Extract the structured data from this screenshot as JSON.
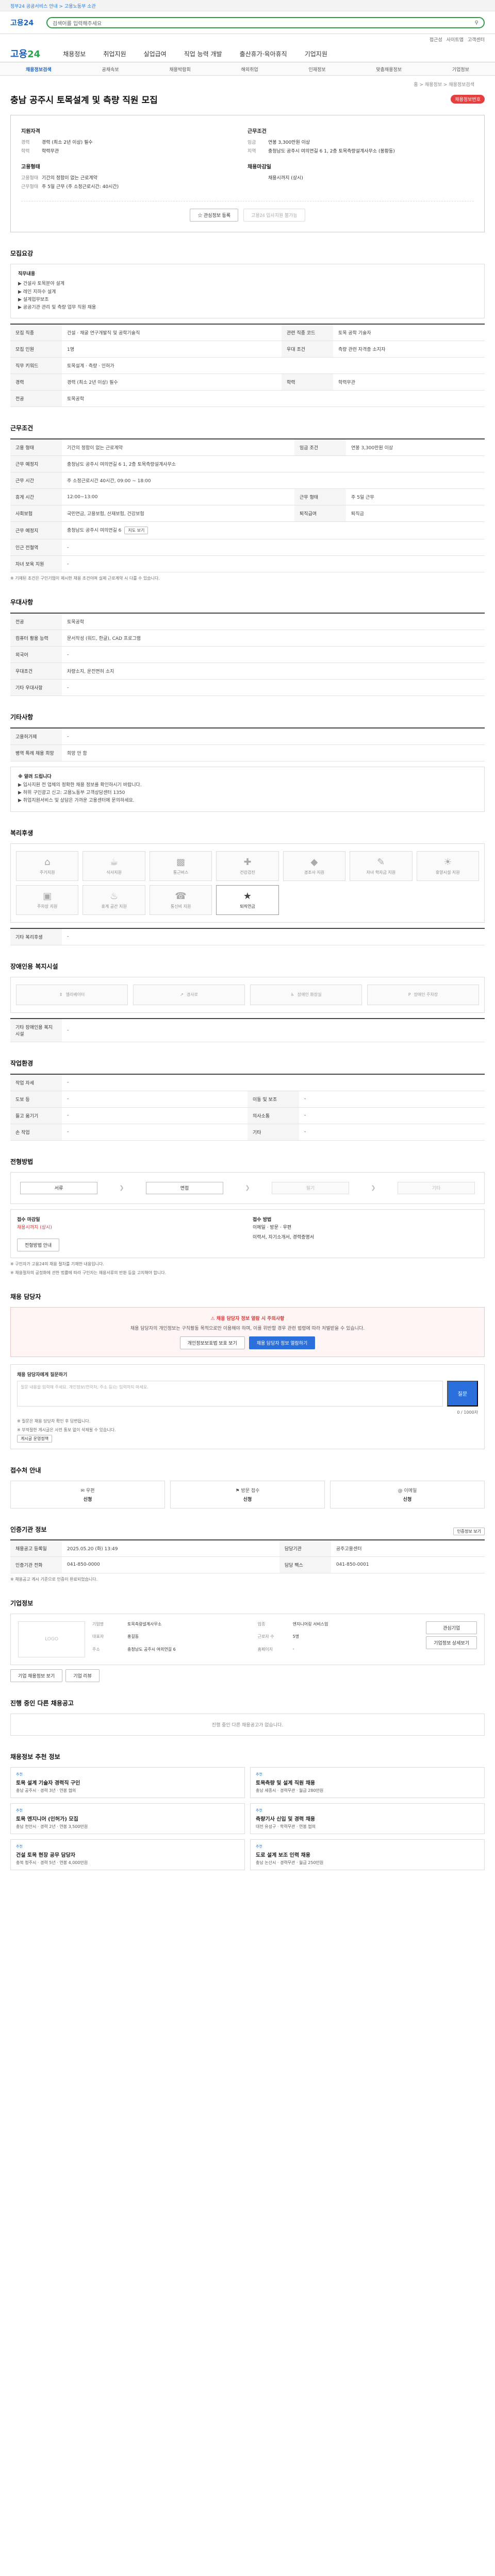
{
  "topbar": {
    "notice": "정부24 공공서비스 안내 > 고용노동부 소관",
    "links": [
      "로그인",
      "회원가입"
    ]
  },
  "search": {
    "logo": "고용24",
    "placeholder": "검색어를 입력해주세요",
    "icon": "search-icon"
  },
  "util": [
    "접근성",
    "사이트맵",
    "고객센터"
  ],
  "mainnav": {
    "logo_a": "고용",
    "logo_b": "24",
    "items": [
      "채용정보",
      "취업지원",
      "실업급여",
      "직업 능력 개발",
      "출산휴가·육아휴직",
      "기업지원"
    ]
  },
  "subnav": {
    "items": [
      "채용정보검색",
      "공채속보",
      "채용박람회",
      "해외취업",
      "인재정보",
      "맞춤채용정보",
      "기업정보"
    ]
  },
  "breadcrumb": "홈 > 채용정보 > 채용정보검색",
  "job": {
    "title": "충남 공주시 토목설계 및 측량 직원 모집",
    "badge": "채용정보번호"
  },
  "summary": {
    "col1_head": "지원자격",
    "col1_lines": [
      {
        "k": "경력",
        "v": "경력 (최소 2년 이상) 필수"
      },
      {
        "k": "학력",
        "v": "학력무관"
      }
    ],
    "col1_head2": "고용형태",
    "col1_lines2": [
      {
        "k": "고용형태",
        "v": "기간의 정함이 없는 근로계약"
      },
      {
        "k": "근무형태",
        "v": "주 5일 근무 (주 소정근로시간: 40시간)"
      }
    ],
    "col2_head": "근무조건",
    "col2_lines": [
      {
        "k": "임금",
        "v": "연봉 3,300만원 이상"
      },
      {
        "k": "지역",
        "v": "충청남도 공주시 여의연길 6 1, 2층 토목측량설계사무소 (봉황동)"
      }
    ],
    "col2_head2": "채용마감일",
    "col2_lines2": [
      {
        "k": "",
        "v": "채용시까지 (상시)"
      }
    ],
    "btn1": "관심정보 등록",
    "btn2": "고용24 입사지원 불가능"
  },
  "sections": {
    "recruit": "모집요강",
    "conditions": "근무조건",
    "welfare_addr": "우대사항",
    "other": "기타사항",
    "welfare": "복리후생",
    "disability": "장애인용 복지시설",
    "process": "전형방법",
    "apply_contact": "채용 담당자",
    "qa": "채용 담당자에게 질문하기",
    "apply_method": "접수처 안내",
    "agency": "인증기관 정보",
    "company": "기업정보",
    "recent": "진행 중인 다른 채용공고",
    "recommend": "채용정보 추천 정보"
  },
  "recruit": {
    "duty_label": "직무내용",
    "duty_lines": [
      "▶ 건설사 토목분야 설계",
      "▶ 레인 지하수 설계",
      "▶ 설계업무보조",
      "▶ 공공기관 관리 및 측량 업무 직원 채용"
    ],
    "rows": [
      {
        "k": "모집 직종",
        "v": "건설 · 채굴 연구개발직 및 공학기술직",
        "k2": "관련 직종 코드",
        "v2": "토목 공학 기술자"
      },
      {
        "k": "모집 인원",
        "v": "1명",
        "k2": "우대 조건",
        "v2": "측량 관련 자격증 소지자"
      },
      {
        "k": "직무 키워드",
        "v": "토목설계 · 측량 · 인허가",
        "k2": "",
        "v2": ""
      },
      {
        "k": "경력",
        "v": "경력 (최소 2년 이상) 필수",
        "k2": "학력",
        "v2": "학력무관"
      },
      {
        "k": "전공",
        "v": "토목공학",
        "k2": "",
        "v2": ""
      }
    ]
  },
  "conditions": {
    "rows": [
      {
        "k": "고용 형태",
        "v": "기간의 정함이 없는 근로계약",
        "k2": "임금 조건",
        "v2": "연봉 3,300만원 이상"
      },
      {
        "k": "근무 예정지",
        "v": "충청남도 공주시 여의연길 6 1, 2층 토목측량설계사무소",
        "k2": "",
        "v2": ""
      },
      {
        "k": "근무 시간",
        "v": "주 소정근로시간 40시간, 09:00 ~ 18:00",
        "k2": "",
        "v2": ""
      },
      {
        "k": "휴게 시간",
        "v": "12:00~13:00",
        "k2": "근무 형태",
        "v2": "주 5일 근무"
      },
      {
        "k": "사회보험",
        "v": "국민연금, 고용보험, 산재보험, 건강보험",
        "k2": "퇴직급여",
        "v2": "퇴직금"
      },
      {
        "k": "근무 예정지",
        "v": "충청남도 공주시 여의연길 6",
        "k2": "",
        "v2": ""
      },
      {
        "k": "인근 전철역",
        "v": "-",
        "k2": "",
        "v2": ""
      },
      {
        "k": "자녀 보육 지원",
        "v": "-",
        "k2": "",
        "v2": ""
      }
    ],
    "map_chip": "지도 보기",
    "note": "※ 기재된 조건은 구인기업이 제시한 채용 조건이며 실제 근로계약 시 다를 수 있습니다."
  },
  "preference": {
    "rows": [
      {
        "k": "전공",
        "v": "토목공학"
      },
      {
        "k": "컴퓨터 활용 능력",
        "v": "문서작성 (워드, 한글), CAD 프로그램"
      },
      {
        "k": "외국어",
        "v": "-"
      },
      {
        "k": "우대조건",
        "v": "차량소지, 운전면허 소지"
      },
      {
        "k": "기타 우대사항",
        "v": "-"
      }
    ]
  },
  "other": {
    "rows": [
      {
        "k": "고용허가제",
        "v": "-"
      },
      {
        "k": "병역 특례 채용 희망",
        "v": "희망 안 함"
      }
    ],
    "memo_title": "※ 알려 드립니다",
    "memo_lines": [
      "▶ 입사지원 전 업체의 정확한 채용 정보를 확인하시기 바랍니다.",
      "▶ 허위 구인광고 신고: 고용노동부 고객상담센터 1350",
      "▶ 취업지원서비스 및 상담은 가까운 고용센터에 문의하세요."
    ]
  },
  "welfare": [
    {
      "icon": "home-icon",
      "label": "주거지원",
      "on": false
    },
    {
      "icon": "meal-icon",
      "label": "식사지원",
      "on": false
    },
    {
      "icon": "bus-icon",
      "label": "통근버스",
      "on": false
    },
    {
      "icon": "health-icon",
      "label": "건강검진",
      "on": false
    },
    {
      "icon": "gift-icon",
      "label": "경조사 지원",
      "on": false
    },
    {
      "icon": "edu-icon",
      "label": "자녀 학자금 지원",
      "on": false
    },
    {
      "icon": "rest-icon",
      "label": "휴양시설 지원",
      "on": false
    },
    {
      "icon": "car-icon",
      "label": "주차장 지원",
      "on": false
    },
    {
      "icon": "coffee-icon",
      "label": "휴게 공간 지원",
      "on": false
    },
    {
      "icon": "phone-icon",
      "label": "통신비 지원",
      "on": false
    },
    {
      "icon": "pension-icon",
      "label": "퇴직연금",
      "on": true
    }
  ],
  "welfare_etc_label": "기타 복리후생",
  "welfare_etc_value": "-",
  "disability": [
    {
      "icon": "elevator-icon",
      "label": "엘리베이터"
    },
    {
      "icon": "ramp-icon",
      "label": "경사로"
    },
    {
      "icon": "toilet-icon",
      "label": "장애인 화장실"
    },
    {
      "icon": "parking-icon",
      "label": "장애인 주차장"
    }
  ],
  "disability_etc_label": "기타 장애인용 복지시설",
  "disability_etc_value": "-",
  "work_env": {
    "title": "작업환경",
    "rows": [
      {
        "k": "작업 자세",
        "v": "-",
        "k2": "",
        "v2": ""
      },
      {
        "k": "도보 등",
        "v": "-",
        "k2": "이동 및 보조",
        "v2": "-"
      },
      {
        "k": "들고 옮기기",
        "v": "-",
        "k2": "의사소통",
        "v2": "-"
      },
      {
        "k": "손 작업",
        "v": "-",
        "k2": "기타",
        "v2": "-"
      }
    ]
  },
  "process": {
    "steps": [
      {
        "label": "서류",
        "dim": false
      },
      {
        "label": "면접",
        "dim": false
      },
      {
        "label": "필기",
        "dim": true
      },
      {
        "label": "기타",
        "dim": true
      }
    ],
    "deadline_label": "접수 마감일",
    "deadline_value": "채용시까지 (상시)",
    "docs_label": "접수 방법",
    "docs_value": "이메일 · 방문 · 우편",
    "docs_detail": "이력서, 자기소개서, 경력증명서",
    "btn": "전형방법 안내",
    "notes": [
      "※ 구인자가 고용24의 채용 절차를 기재한 내용입니다.",
      "※ 채용절차의 공정화에 관한 법률에 따라 구인자는 채용서류의 반환 등을 고지해야 합니다."
    ]
  },
  "contact": {
    "warn_title": "채용 담당자 정보 열람 시 주의사항",
    "warn_text": "채용 담당자의 개인정보는 구직활동 목적으로만 이용해야 하며, 이를 위반할 경우 관련 법령에 따라 처벌받을 수 있습니다.",
    "btn1": "개인정보보호법 보호 보기",
    "btn2": "채용 담당자 정보 열람하기"
  },
  "qa": {
    "label": "채용 담당자에게 질문하기",
    "placeholder": "질문 내용을 입력해 주세요. 개인정보(연락처, 주소 등)는 입력하지 마세요.",
    "counter": "0 / 1000자",
    "btn": "질문",
    "notes": [
      "※ 질문은 채용 담당자 확인 후 답변됩니다.",
      "※ 부적절한 게시글은 사전 통보 없이 삭제될 수 있습니다."
    ],
    "link": "게시글 운영정책"
  },
  "apply_method": [
    {
      "icon": "mail-icon",
      "label": "우편",
      "value": "신청"
    },
    {
      "icon": "visit-icon",
      "label": "방문 접수",
      "value": "신청"
    },
    {
      "icon": "email-icon",
      "label": "이메일",
      "value": "신청"
    }
  ],
  "agency": {
    "print_btn": "인증정보 보기",
    "rows": [
      {
        "k": "채용공고 등록일",
        "v": "2025.05.20 (화) 13:49",
        "k2": "담당기관",
        "v2": "공주고용센터"
      },
      {
        "k": "인증기관 전화",
        "v": "041-850-0000",
        "k2": "담당 팩스",
        "v2": "041-850-0001"
      }
    ],
    "note": "※ 채용공고 게시 기준으로 인증이 완료되었습니다."
  },
  "company": {
    "logo_text": "LOGO",
    "rows": [
      {
        "k": "기업명",
        "v": "토목측량설계사무소",
        "k2": "업종",
        "v2": "엔지니어링 서비스업"
      },
      {
        "k": "대표자",
        "v": "홍길동",
        "k2": "근로자 수",
        "v2": "5명"
      },
      {
        "k": "주소",
        "v": "충청남도 공주시 여의연길 6",
        "k2": "홈페이지",
        "v2": "-"
      }
    ],
    "btn1": "관심기업",
    "btn2": "기업정보 상세보기",
    "btn3": "기업 채용정보 보기",
    "btn4": "기업 리뷰"
  },
  "recent_empty": "진행 중인 다른 채용공고가 없습니다.",
  "recommend": [
    {
      "tag": "추천",
      "title": "토목 설계 기술자 경력직 구인",
      "meta": "충남 공주시 · 경력 3년 · 연봉 협의"
    },
    {
      "tag": "추천",
      "title": "토목측량 및 설계 직원 채용",
      "meta": "충남 세종시 · 경력무관 · 월급 280만원"
    },
    {
      "tag": "추천",
      "title": "토목 엔지니어 (인허가) 모집",
      "meta": "충남 천안시 · 경력 2년 · 연봉 3,500만원"
    },
    {
      "tag": "추천",
      "title": "측량기사 신입 및 경력 채용",
      "meta": "대전 유성구 · 학력무관 · 연봉 협의"
    },
    {
      "tag": "추천",
      "title": "건설 토목 현장 공무 담당자",
      "meta": "충북 청주시 · 경력 5년 · 연봉 4,000만원"
    },
    {
      "tag": "추천",
      "title": "도로 설계 보조 인력 채용",
      "meta": "충남 논산시 · 경력무관 · 월급 250만원"
    }
  ]
}
